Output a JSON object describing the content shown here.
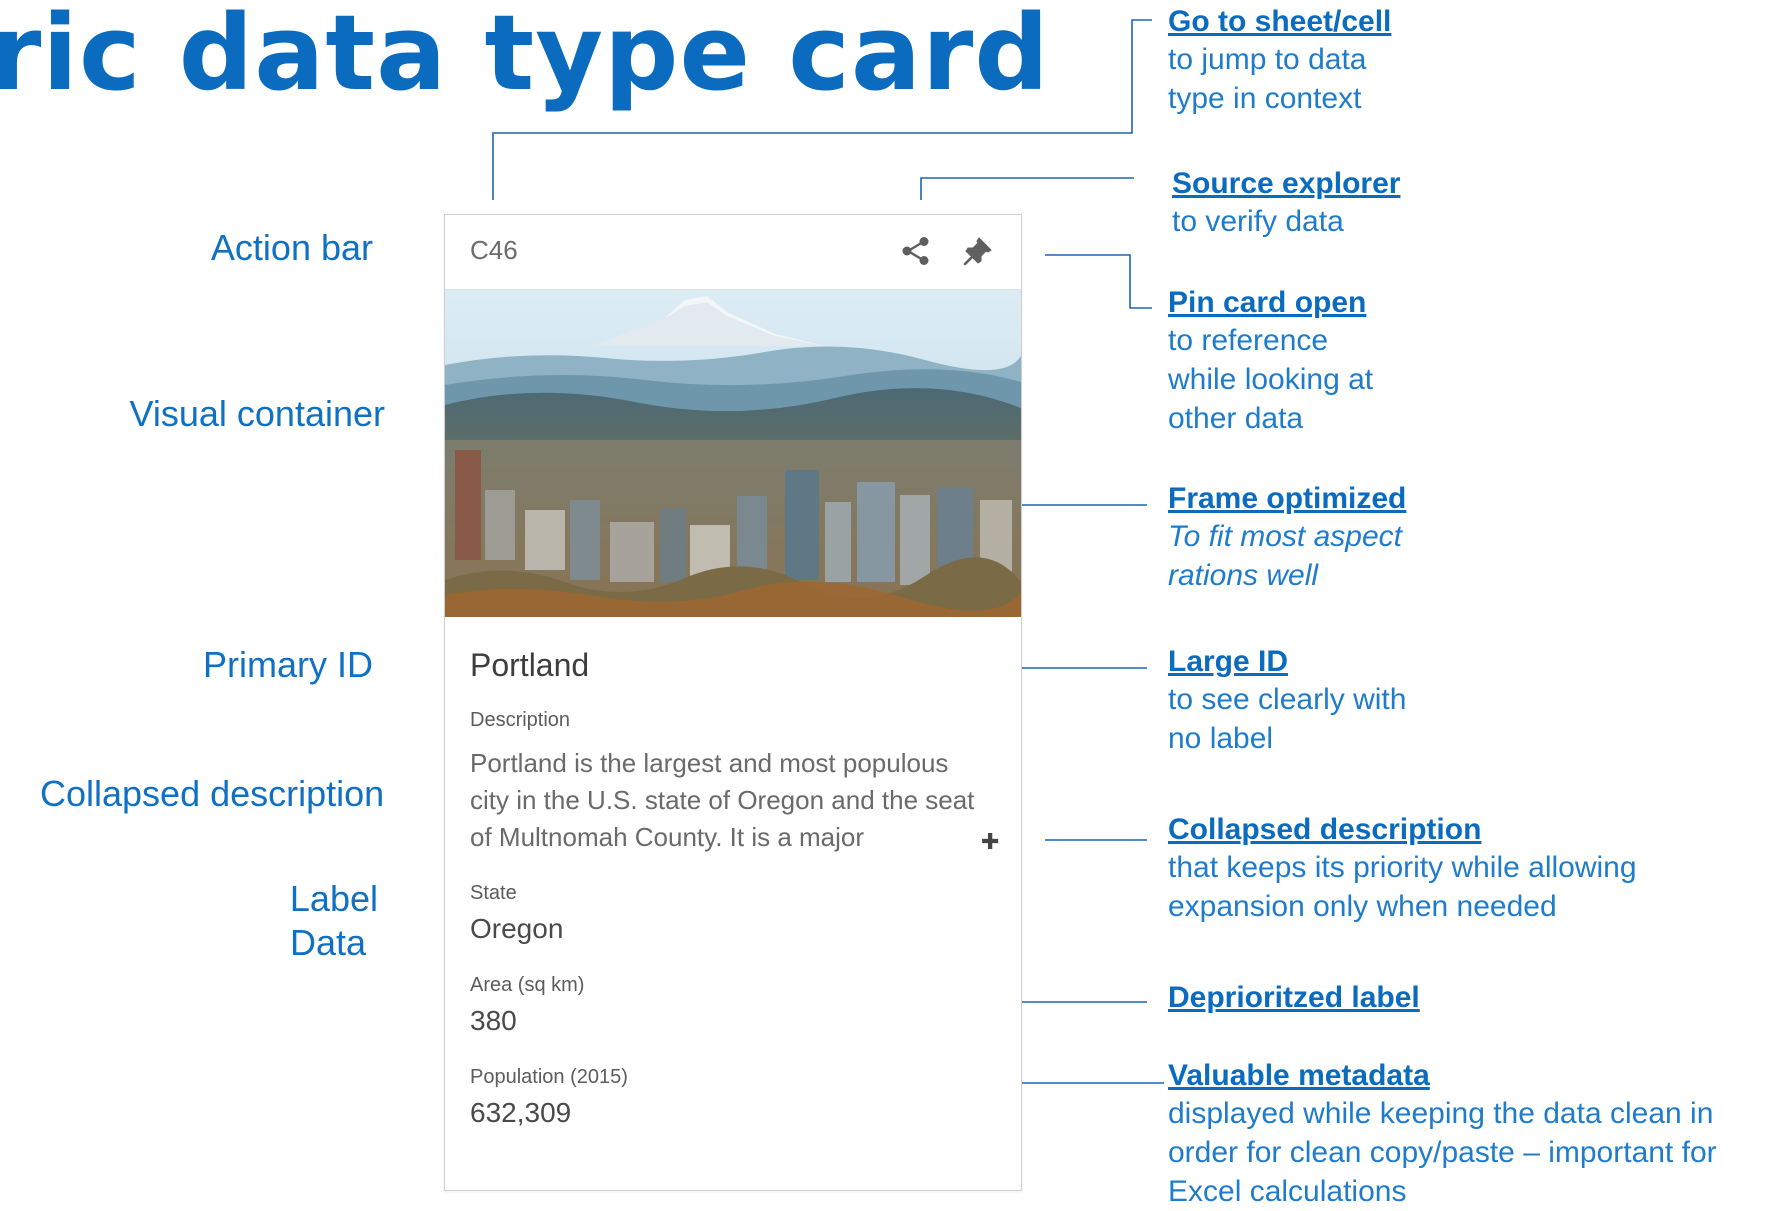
{
  "title": "ric data type card",
  "left_labels": {
    "action_bar": "Action bar",
    "visual_container": "Visual container",
    "primary_id": "Primary ID",
    "collapsed_description": "Collapsed description",
    "label": "Label",
    "data": "Data"
  },
  "card": {
    "cell_ref": "C46",
    "primary_id": "Portland",
    "description_label": "Description",
    "description_text": "Portland is the largest and most populous city in the U.S. state of Oregon and the seat of Multnomah County. It is a major",
    "fields": [
      {
        "label": "State",
        "value": "Oregon"
      },
      {
        "label": "Area (sq km)",
        "value": "380"
      },
      {
        "label": "Population (2015)",
        "value": "632,309"
      }
    ]
  },
  "annotations": {
    "go_to_cell": {
      "title": "Go to sheet/cell",
      "desc": "to jump to data\ntype in context"
    },
    "source_explorer": {
      "title": "Source explorer",
      "desc": "to verify data"
    },
    "pin_card": {
      "title": "Pin card open",
      "desc": "to reference\nwhile looking at\nother data"
    },
    "frame_optimized": {
      "title": "Frame optimized",
      "desc": "To fit most aspect\nrations well"
    },
    "large_id": {
      "title": "Large ID",
      "desc": "to see clearly with\nno label"
    },
    "collapsed_description": {
      "title": "Collapsed description",
      "desc": "that keeps its priority while allowing\nexpansion only when needed"
    },
    "deprioritized_label": {
      "title": "Deprioritzed label"
    },
    "valuable_metadata": {
      "title": "Valuable metadata",
      "desc": "displayed while keeping the data clean in\norder for clean copy/paste – important for\nExcel calculations"
    }
  },
  "colors": {
    "accent": "#0a6bbf",
    "annotation_text": "#1f7ccc",
    "leader_line": "#1b66b8"
  },
  "icons": [
    "share-icon",
    "pin-icon",
    "expand-plus-icon"
  ]
}
